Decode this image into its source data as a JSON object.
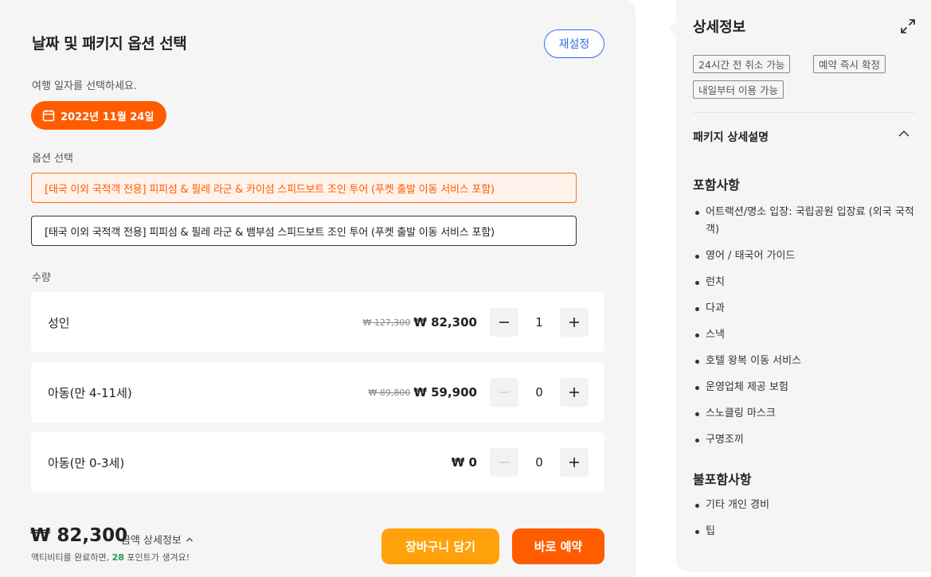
{
  "left": {
    "title": "날짜 및 패키지 옵션 선택",
    "reset_label": "재설정",
    "date_prompt": "여행 일자를 선택하세요.",
    "selected_date": "2022년 11월 24일",
    "option_label": "옵션 선택",
    "options": [
      {
        "label": "[태국 이외 국적객 전용] 피피섬 & 필레 라군 & 카이섬 스피드보트 조인 투어 (푸켓 출발 이동 서비스 포함)",
        "selected": true
      },
      {
        "label": "[태국 이외 국적객 전용] 피피섬 & 필레 라군 & 뱀부섬 스피드보트 조인 투어 (푸켓 출발 이동 서비스 포함)",
        "selected": false
      }
    ],
    "quantity_label": "수량",
    "quantities": [
      {
        "label": "성인",
        "original_price": "₩ 127,300",
        "price": "₩ 82,300",
        "count": "1",
        "minus_disabled": false
      },
      {
        "label": "아동(만 4-11세)",
        "original_price": "₩ 89,800",
        "price": "₩ 59,900",
        "count": "0",
        "minus_disabled": true
      },
      {
        "label": "아동(만 0-3세)",
        "original_price": "",
        "price": "₩ 0",
        "count": "0",
        "minus_disabled": true
      }
    ],
    "total_price": "₩ 82,300",
    "price_detail_label": "금액 상세정보",
    "points_note_prefix": "액티비티를 완료하면, ",
    "points_value": "28",
    "points_note_suffix": " 포인트가 생겨요!",
    "cart_label": "장바구니 담기",
    "book_label": "바로 예약"
  },
  "right": {
    "title": "상세정보",
    "tags": [
      "24시간 전 취소 가능",
      "예약 즉시 확정",
      "내일부터 이용 가능"
    ],
    "package_header": "패키지 상세설명",
    "included_heading": "포함사항",
    "included_items": [
      "어트랙션/명소 입장: 국립공원 입장료 (외국 국적객)",
      "영어 / 태국어 가이드",
      "런치",
      "다과",
      "스낵",
      "호텔 왕복 이동 서비스",
      "운영업체 제공 보험",
      "스노클링 마스크",
      "구명조끼"
    ],
    "excluded_heading": "불포함사항",
    "excluded_items": [
      "기타 개인 경비",
      "팁"
    ]
  },
  "colors": {
    "accent_orange": "#ff5c00",
    "cart_orange": "#ffa10a",
    "reset_blue": "#2f6fe4",
    "points_green": "#1aa34a"
  },
  "icons": [
    "calendar-icon",
    "minus-icon",
    "plus-icon",
    "chevron-up-icon",
    "expand-icon"
  ]
}
